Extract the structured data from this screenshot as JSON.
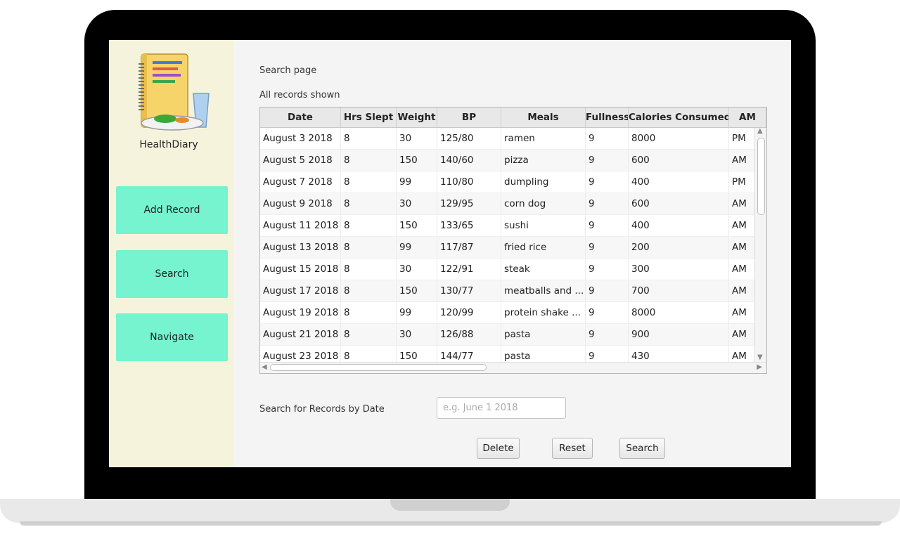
{
  "app": {
    "name": "HealthDiary"
  },
  "sidebar": {
    "buttons": [
      {
        "label": "Add Record"
      },
      {
        "label": "Search"
      },
      {
        "label": "Navigate"
      }
    ]
  },
  "page": {
    "title": "Search page",
    "status": "All records shown"
  },
  "table": {
    "columns": [
      "Date",
      "Hrs Slept",
      "Weight",
      "BP",
      "Meals",
      "Fullness",
      "Calories Consumed",
      "AM"
    ],
    "rows": [
      [
        "August 3 2018",
        "8",
        "30",
        "125/80",
        "ramen",
        "9",
        "8000",
        "PM"
      ],
      [
        "August 5 2018",
        "8",
        "150",
        "140/60",
        "pizza",
        "9",
        "600",
        "AM"
      ],
      [
        "August 7 2018",
        "8",
        "99",
        "110/80",
        "dumpling",
        "9",
        "400",
        "PM"
      ],
      [
        "August 9 2018",
        "8",
        "30",
        "129/95",
        "corn dog",
        "9",
        "600",
        "AM"
      ],
      [
        "August 11 2018",
        "8",
        "150",
        "133/65",
        "sushi",
        "9",
        "400",
        "AM"
      ],
      [
        "August 13 2018",
        "8",
        "99",
        "117/87",
        "fried rice",
        "9",
        "200",
        "AM"
      ],
      [
        "August 15 2018",
        "8",
        "30",
        "122/91",
        "steak",
        "9",
        "300",
        "AM"
      ],
      [
        "August 17 2018",
        "8",
        "150",
        "130/77",
        "meatballs and ...",
        "9",
        "700",
        "AM"
      ],
      [
        "August 19 2018",
        "8",
        "99",
        "120/99",
        "protein shake ...",
        "9",
        "8000",
        "AM"
      ],
      [
        "August 21 2018",
        "8",
        "30",
        "126/88",
        "pasta",
        "9",
        "900",
        "AM"
      ],
      [
        "August 23 2018",
        "8",
        "150",
        "144/77",
        "pasta",
        "9",
        "430",
        "AM"
      ]
    ]
  },
  "search": {
    "label": "Search for Records by Date",
    "placeholder": "e.g. June 1 2018",
    "value": ""
  },
  "actions": {
    "delete": "Delete",
    "reset": "Reset",
    "search": "Search"
  },
  "icons": {
    "logo": "notebook-meal-icon",
    "scroll_up": "▲",
    "scroll_down": "▼",
    "scroll_left": "◀",
    "scroll_right": "▶"
  }
}
